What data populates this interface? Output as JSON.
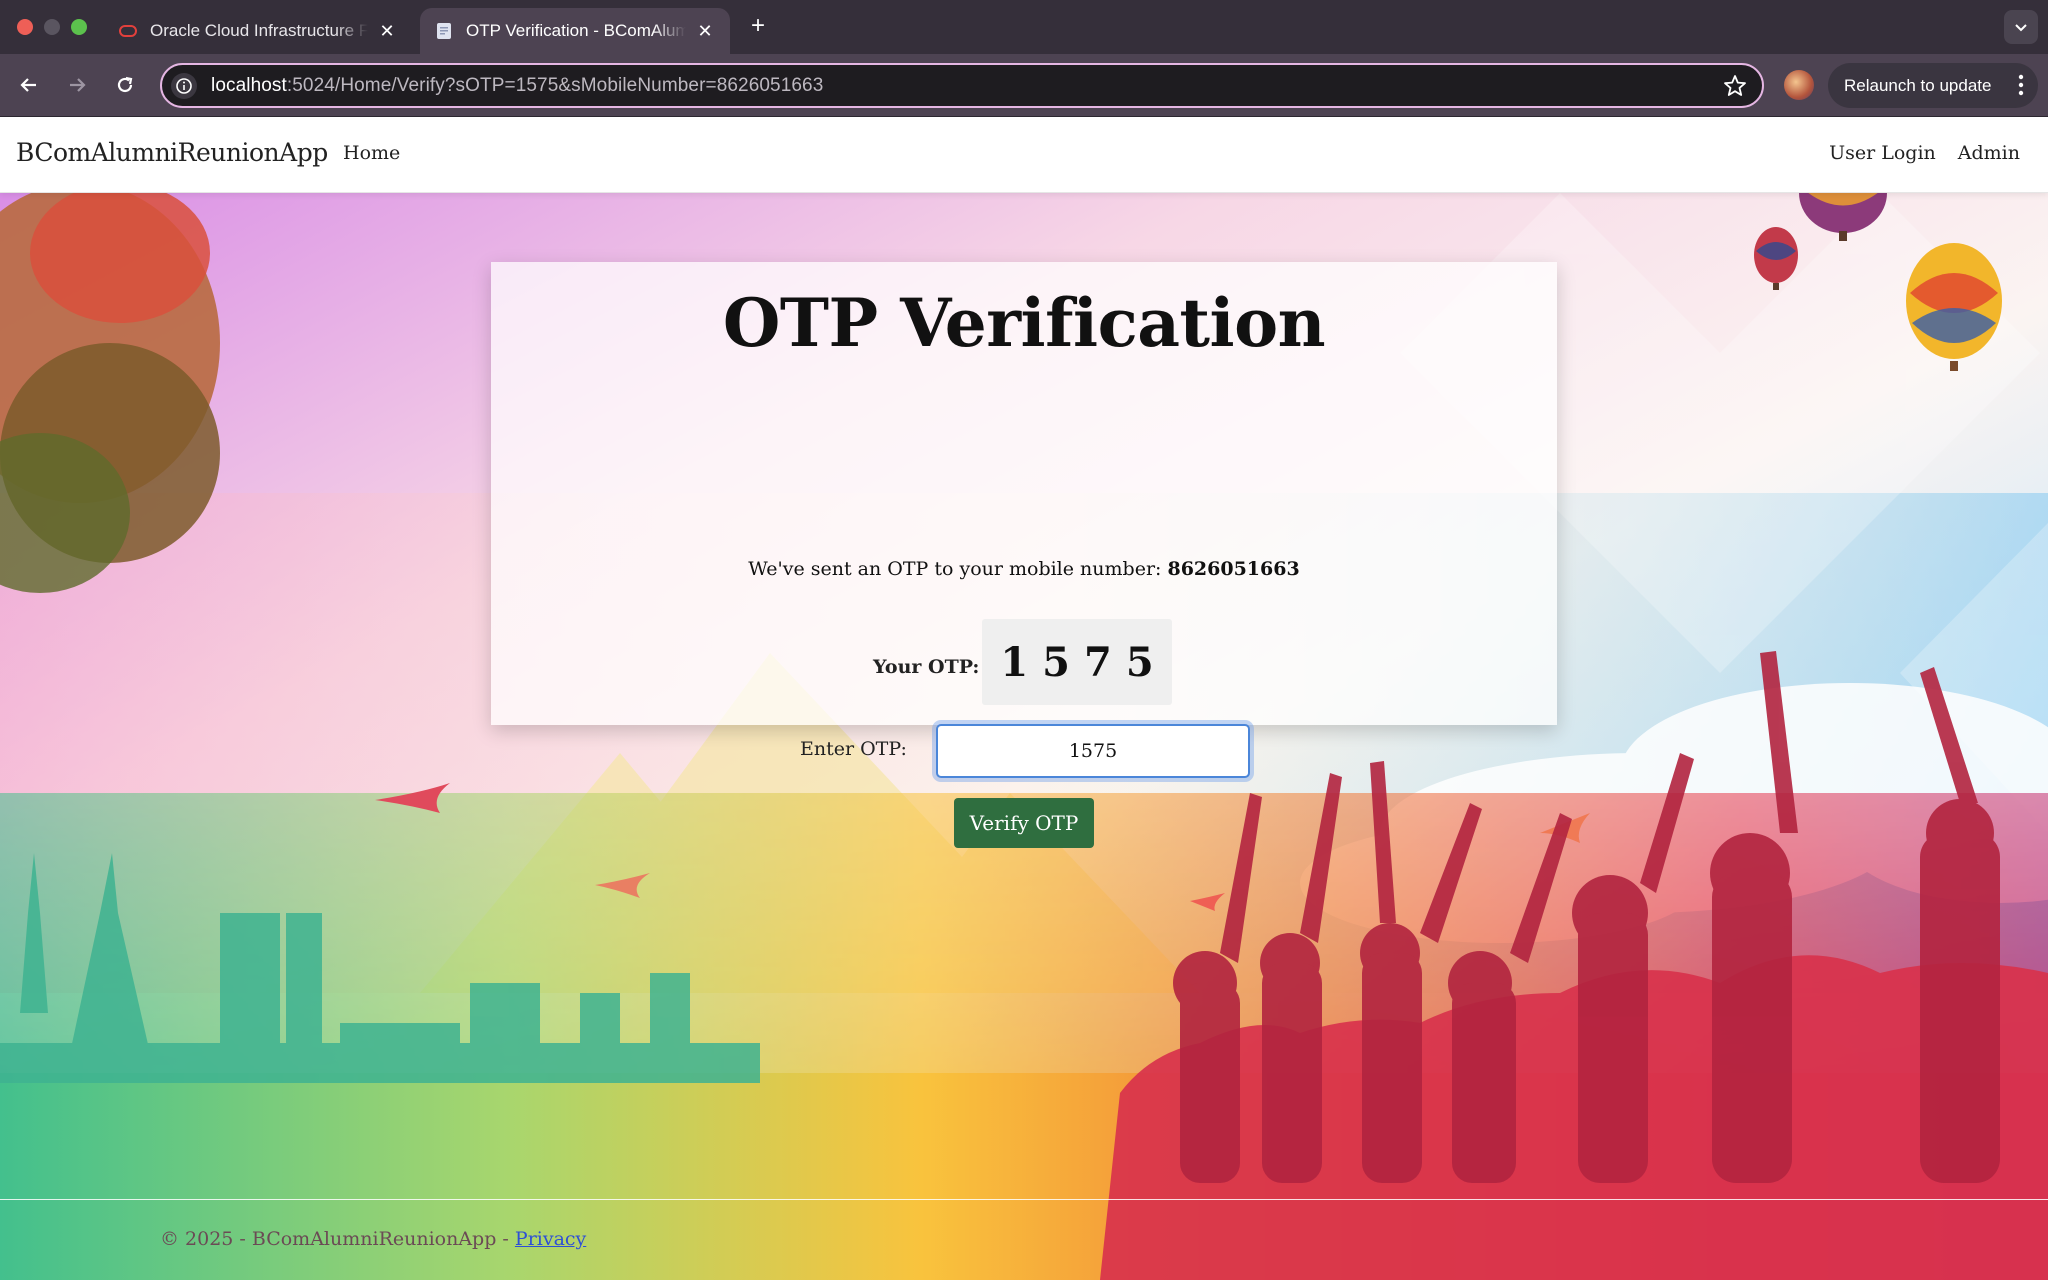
{
  "browser": {
    "tabs": [
      {
        "title": "Oracle Cloud Infrastructure Federated Login",
        "icon": "oracle-icon",
        "active": false
      },
      {
        "title": "OTP Verification - BComAlumniReunionApp",
        "icon": "document-icon",
        "active": true
      }
    ],
    "url_host": "localhost",
    "url_rest": ":5024/Home/Verify?sOTP=1575&sMobileNumber=8626051663",
    "relaunch_label": "Relaunch to update"
  },
  "nav": {
    "brand": "BComAlumniReunionApp",
    "home": "Home",
    "user_login": "User Login",
    "admin": "Admin"
  },
  "otp_card": {
    "title": "OTP Verification",
    "sent_message": "We've sent an OTP to your mobile number:",
    "mobile_number": "8626051663",
    "your_otp_label": "Your OTP:",
    "otp_value": "1575",
    "enter_otp_label": "Enter OTP:",
    "entered_otp": "1575",
    "verify_button": "Verify OTP"
  },
  "footer": {
    "copyright": "© 2025 - BComAlumniReunionApp -",
    "privacy_link": "Privacy"
  },
  "colors": {
    "verify_button": "#2f6e3f",
    "input_focus": "#4b86d9",
    "omnibox_border": "#e5b6e3",
    "tabbar": "#352f3a"
  }
}
